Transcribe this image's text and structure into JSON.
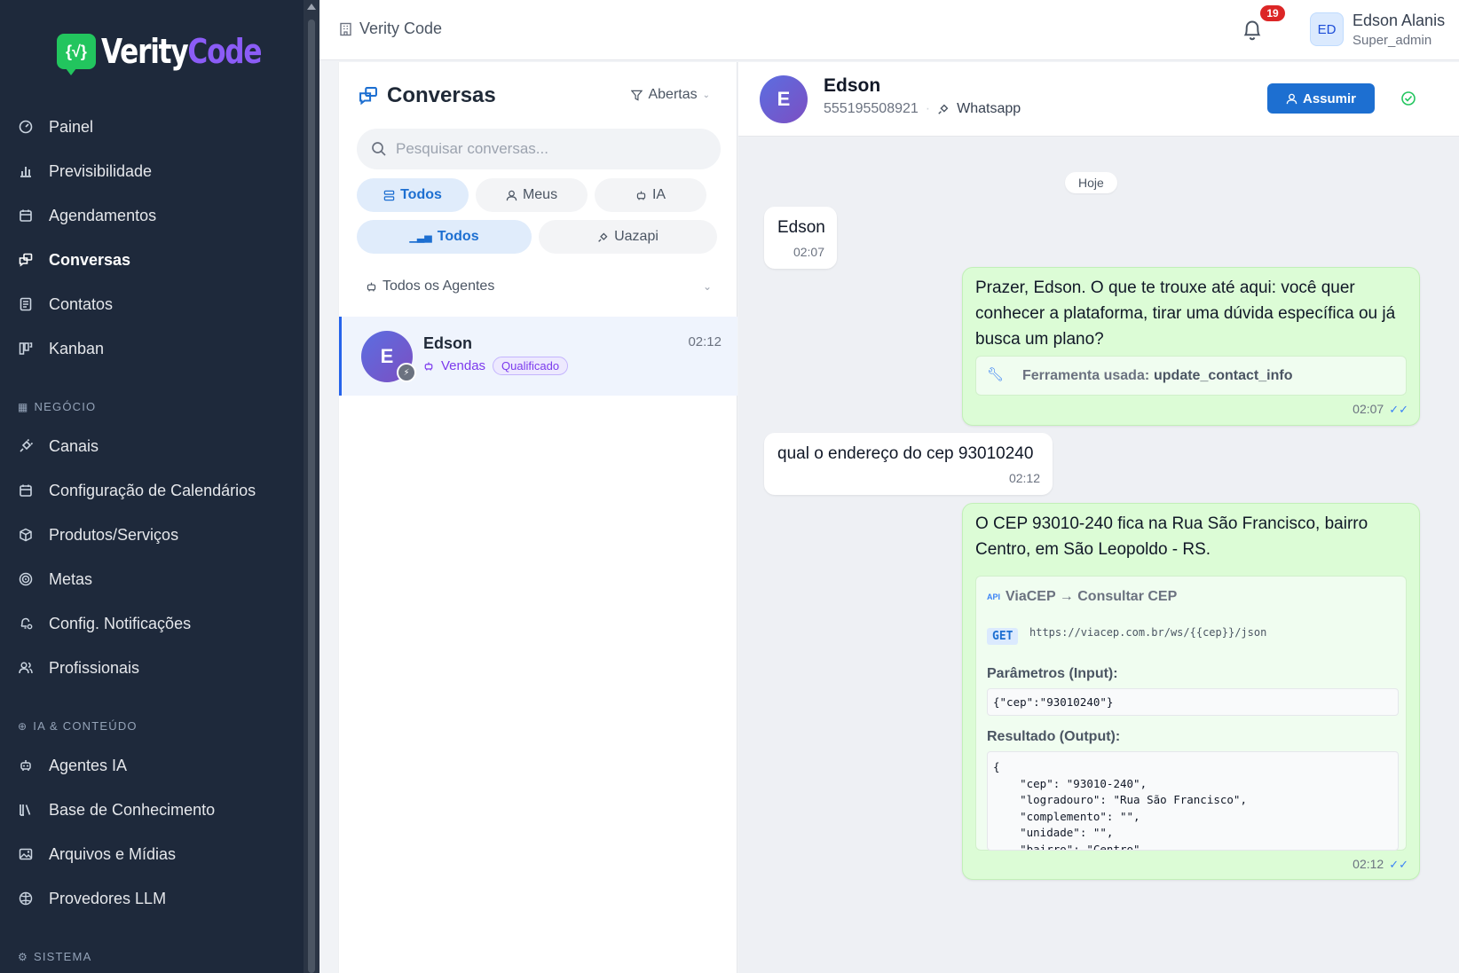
{
  "app": {
    "logo_part1": "Verity",
    "logo_part2": "Code",
    "logo_badge": "{√}",
    "colors": {
      "sidebar": "#1e293b",
      "accent": "#1d6fd1",
      "brand_green": "#22c55e",
      "brand_purple": "#8b5cf6"
    }
  },
  "sidebar": {
    "items_main": [
      {
        "label": "Painel",
        "icon": "gauge-icon"
      },
      {
        "label": "Previsibilidade",
        "icon": "bar-chart-icon"
      },
      {
        "label": "Agendamentos",
        "icon": "calendar-icon"
      },
      {
        "label": "Conversas",
        "icon": "chat-icon",
        "active": true
      },
      {
        "label": "Contatos",
        "icon": "contacts-icon"
      },
      {
        "label": "Kanban",
        "icon": "kanban-icon"
      }
    ],
    "section_business": "NEGÓCIO",
    "items_business": [
      {
        "label": "Canais",
        "icon": "plug-icon"
      },
      {
        "label": "Configuração de Calendários",
        "icon": "calendar-icon"
      },
      {
        "label": "Produtos/Serviços",
        "icon": "box-icon"
      },
      {
        "label": "Metas",
        "icon": "target-icon"
      },
      {
        "label": "Config. Notificações",
        "icon": "bell-gear-icon"
      },
      {
        "label": "Profissionais",
        "icon": "users-icon"
      }
    ],
    "section_ai": "IA & CONTEÚDO",
    "items_ai": [
      {
        "label": "Agentes IA",
        "icon": "robot-icon"
      },
      {
        "label": "Base de Conhecimento",
        "icon": "library-icon"
      },
      {
        "label": "Arquivos e Mídias",
        "icon": "image-icon"
      },
      {
        "label": "Provedores LLM",
        "icon": "brain-icon"
      }
    ],
    "section_system": "SISTEMA"
  },
  "header": {
    "breadcrumb": "Verity Code",
    "notifications": "19",
    "user_initials": "ED",
    "user_name": "Edson Alanis",
    "user_role": "Super_admin"
  },
  "conversations": {
    "title": "Conversas",
    "filter_status": "Abertas",
    "search_placeholder": "Pesquisar conversas...",
    "owner_tabs": [
      "Todos",
      "Meus",
      "IA"
    ],
    "channel_tabs": [
      "Todos",
      "Uazapi"
    ],
    "agent_filter": "Todos os Agentes",
    "items": [
      {
        "initial": "E",
        "name": "Edson",
        "time": "02:12",
        "agent": "Vendas",
        "tag": "Qualificado"
      }
    ]
  },
  "chat": {
    "contact_initial": "E",
    "contact_name": "Edson",
    "phone": "555195508921",
    "channel": "Whatsapp",
    "assume_label": "Assumir",
    "day_label": "Hoje",
    "messages": [
      {
        "dir": "in",
        "text": "Edson",
        "time": "02:07"
      },
      {
        "dir": "out",
        "text": "Prazer, Edson. O que te trouxe até aqui: você quer conhecer a plataforma, tirar uma dúvida específica ou já busca um plano?",
        "tool_label": "Ferramenta usada:",
        "tool_name": "update_contact_info",
        "time": "02:07"
      },
      {
        "dir": "in",
        "text": "qual o endereço do cep 93010240",
        "time": "02:12"
      },
      {
        "dir": "out",
        "text": "O CEP 93010-240 fica na Rua São Francisco, bairro Centro, em São Leopoldo - RS.",
        "api_title": "ViaCEP → Consultar CEP",
        "api_method": "GET",
        "api_url": "https://viacep.com.br/ws/{{cep}}/json",
        "params_label": "Parâmetros (Input):",
        "params": "{\"cep\":\"93010240\"}",
        "result_label": "Resultado (Output):",
        "result": "{\n    \"cep\": \"93010-240\",\n    \"logradouro\": \"Rua São Francisco\",\n    \"complemento\": \"\",\n    \"unidade\": \"\",\n    \"bairro\": \"Centro\",",
        "time": "02:12"
      }
    ]
  }
}
